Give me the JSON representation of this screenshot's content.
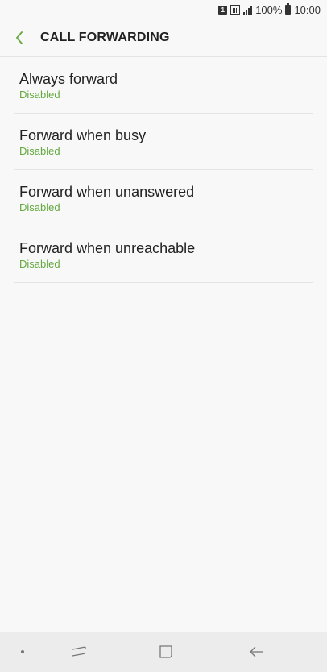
{
  "status_bar": {
    "sim_slot": "1",
    "battery_percent": "100%",
    "time": "10:00"
  },
  "header": {
    "title": "CALL FORWARDING",
    "accent_color": "#64a93f"
  },
  "forwarding_options": [
    {
      "title": "Always forward",
      "status": "Disabled"
    },
    {
      "title": "Forward when busy",
      "status": "Disabled"
    },
    {
      "title": "Forward when unanswered",
      "status": "Disabled"
    },
    {
      "title": "Forward when unreachable",
      "status": "Disabled"
    }
  ],
  "nav_bar": {
    "buttons": [
      "dot-icon",
      "recents-icon",
      "home-icon",
      "back-arrow-icon"
    ]
  }
}
